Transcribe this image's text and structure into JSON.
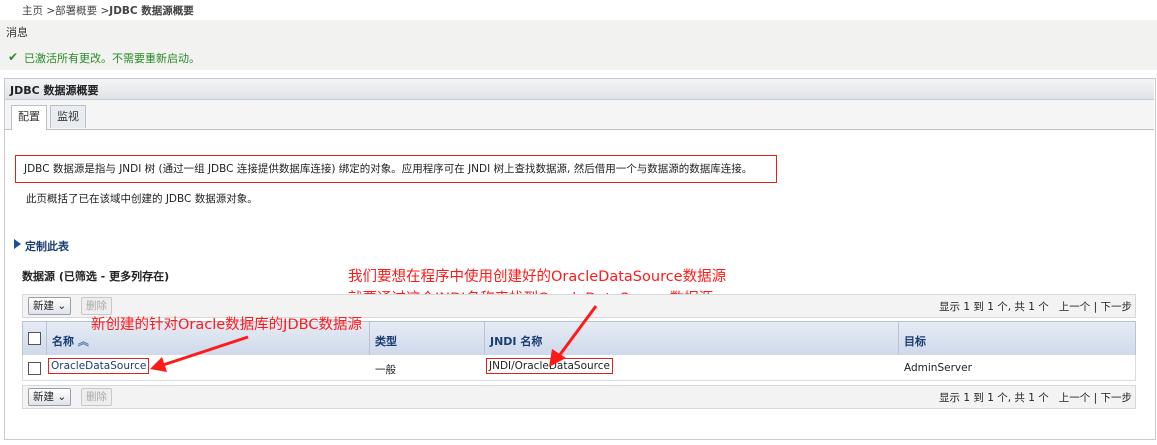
{
  "breadcrumb": {
    "home": "主页",
    "sep1": " >",
    "summary": "部署概要",
    "sep2": " >",
    "current": "JDBC 数据源概要"
  },
  "messages": {
    "title": "消息",
    "text": "已激活所有更改。不需要重新启动。"
  },
  "panel": {
    "title": "JDBC 数据源概要"
  },
  "tabs": [
    {
      "label": "配置"
    },
    {
      "label": "监视"
    }
  ],
  "description": "JDBC 数据源是指与 JNDI 树 (通过一组 JDBC 连接提供数据库连接) 绑定的对象。应用程序可在 JNDI 树上查找数据源, 然后借用一个与数据源的数据库连接。",
  "description2": "此页概括了已在该域中创建的 JDBC 数据源对象。",
  "customize": "定制此表",
  "table_title": "数据源 (已筛选 - 更多列存在)",
  "toolbar": {
    "new_label": "新建",
    "delete_label": "删除"
  },
  "pager": {
    "text": "显示 1 到 1 个, 共 1 个",
    "prev": "上一个",
    "sep": " | ",
    "next": "下一步"
  },
  "columns": {
    "name": "名称",
    "type": "类型",
    "jndi": "JNDI 名称",
    "target": "目标"
  },
  "rows": [
    {
      "name": "OracleDataSource",
      "type": "一般",
      "jndi": "JNDI/OracleDataSource",
      "target": "AdminServer"
    }
  ],
  "annotations": {
    "line1": "我们要想在程序中使用创建好的OracleDataSource数据源",
    "line2": "就要通过这个JNDI名称来找到OracleDataSource数据源",
    "line3": "新创建的针对Oracle数据库的JDBC数据源"
  },
  "colors": {
    "annotation": "#ff1a1a",
    "link": "#1a3e73",
    "success": "#2a8a2a"
  }
}
